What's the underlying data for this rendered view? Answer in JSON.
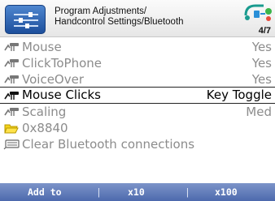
{
  "header": {
    "title_line1": "Program Adjustments/",
    "title_line2": "Handcontrol Settings/Bluetooth",
    "page_indicator": "4/7"
  },
  "items": [
    {
      "label": "Mouse",
      "value": "Yes",
      "icon": "bluetooth-device-icon"
    },
    {
      "label": "ClickToPhone",
      "value": "Yes",
      "icon": "bluetooth-device-icon"
    },
    {
      "label": "VoiceOver",
      "value": "Yes",
      "icon": "bluetooth-device-icon"
    },
    {
      "label": "Mouse Clicks",
      "value": "Key Toggle",
      "icon": "bluetooth-device-icon",
      "selected": true
    },
    {
      "label": "Scaling",
      "value": "Med",
      "icon": "bluetooth-device-icon"
    },
    {
      "label": "0x8840",
      "value": "",
      "icon": "folder-icon"
    },
    {
      "label": "Clear Bluetooth connections",
      "value": "",
      "icon": "keyboard-icon"
    }
  ],
  "footer": {
    "btn1": "Add to",
    "btn2": "x10",
    "btn3": "x100",
    "separator": "|"
  },
  "colors": {
    "footer_bar": "#5d78b8",
    "app_icon": "#2d62b4",
    "dimmed_text": "#8c8c8c",
    "selected_text": "#000000"
  }
}
